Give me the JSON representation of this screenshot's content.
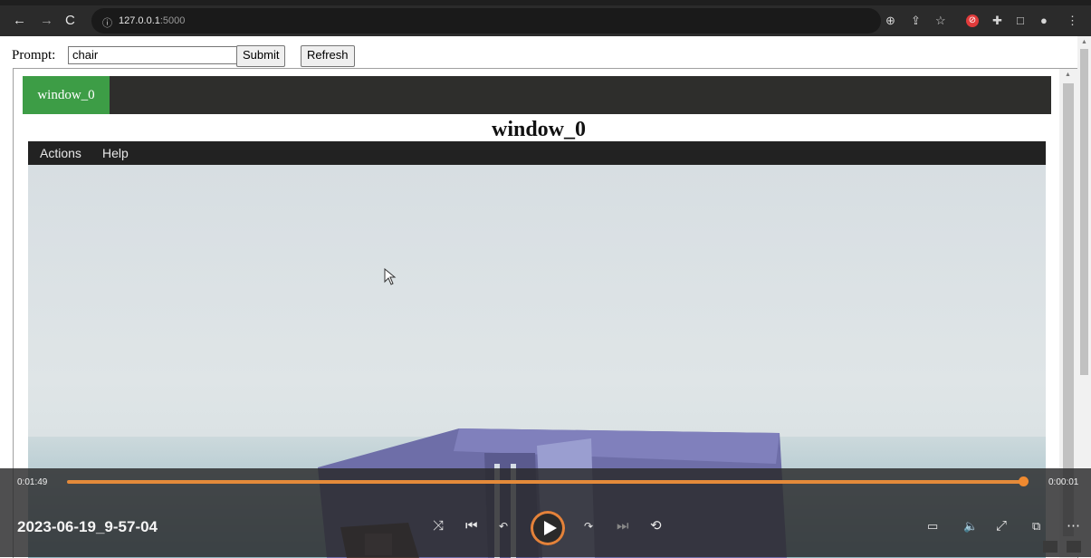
{
  "browser": {
    "url_host": "127.0.0.1",
    "url_port": ":5000",
    "info_icon": "info-icon"
  },
  "form": {
    "prompt_label": "Prompt:",
    "prompt_value": "chair",
    "submit_label": "Submit",
    "refresh_label": "Refresh"
  },
  "viewer": {
    "tab_label": "window_0",
    "window_title": "window_0",
    "menu": [
      "Actions",
      "Help"
    ]
  },
  "player": {
    "elapsed": "0:01:49",
    "remaining": "0:00:01",
    "file_name": "2023-06-19_9-57-04",
    "progress": 0.99,
    "accent_color": "#e48a3a"
  }
}
